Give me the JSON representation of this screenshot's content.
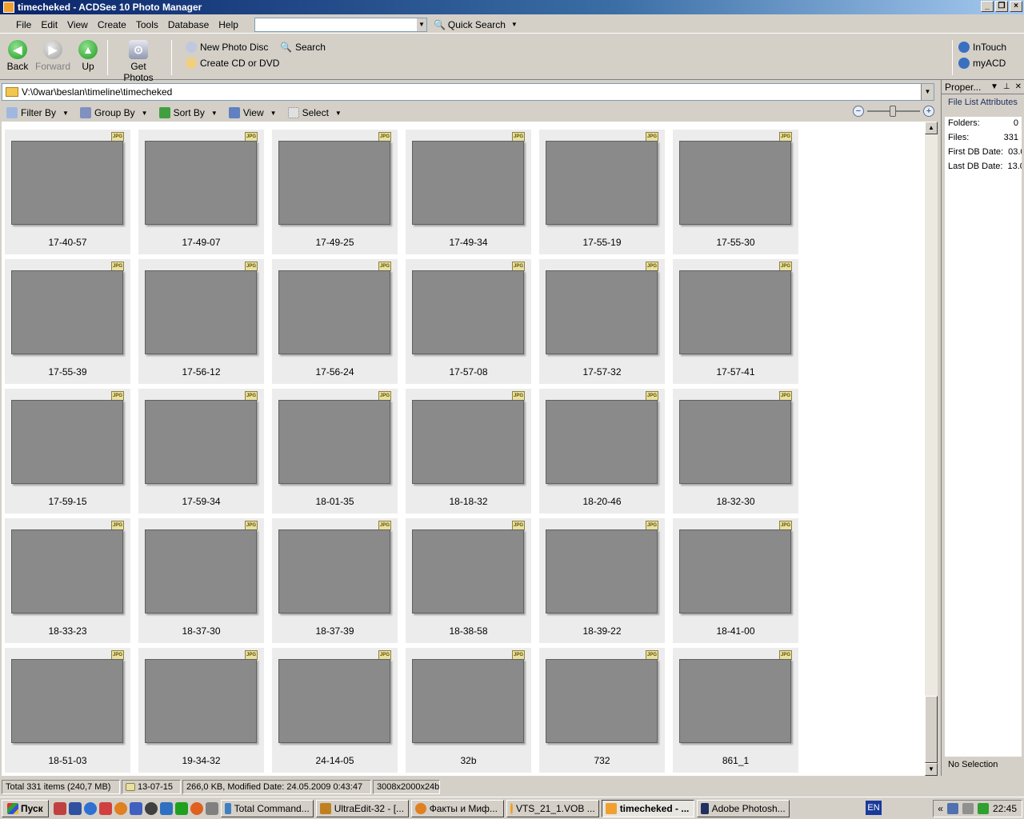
{
  "window": {
    "title": "timecheked - ACDSee 10 Photo Manager",
    "controls": [
      "_",
      "❐",
      "×"
    ]
  },
  "menu": {
    "items": [
      "File",
      "Edit",
      "View",
      "Create",
      "Tools",
      "Database",
      "Help"
    ],
    "quick_search": "Quick Search"
  },
  "toolbar": {
    "back": "Back",
    "forward": "Forward",
    "up": "Up",
    "get_photos": "Get Photos",
    "new_photo_disc": "New Photo Disc",
    "create_cd": "Create CD or DVD",
    "search": "Search",
    "intouch": "InTouch",
    "myacd": "myACD"
  },
  "path": "V:\\0war\\beslan\\timeline\\timecheked",
  "filterbar": {
    "filter_by": "Filter By",
    "group_by": "Group By",
    "sort_by": "Sort By",
    "view": "View",
    "select": "Select"
  },
  "badge_label": "JPG",
  "files": [
    "17-40-57",
    "17-49-07",
    "17-49-25",
    "17-49-34",
    "17-55-19",
    "17-55-30",
    "17-55-39",
    "17-56-12",
    "17-56-24",
    "17-57-08",
    "17-57-32",
    "17-57-41",
    "17-59-15",
    "17-59-34",
    "18-01-35",
    "18-18-32",
    "18-20-46",
    "18-32-30",
    "18-33-23",
    "18-37-30",
    "18-37-39",
    "18-38-58",
    "18-39-22",
    "18-41-00",
    "18-51-03",
    "19-34-32",
    "24-14-05",
    "32b",
    "732",
    "861_1"
  ],
  "properties": {
    "title": "Proper...",
    "tab": "File List Attributes",
    "rows": [
      {
        "label": "Folders:",
        "value": "0"
      },
      {
        "label": "Files:",
        "value": "331"
      },
      {
        "label": "First DB Date:",
        "value": "03.0"
      },
      {
        "label": "Last DB Date:",
        "value": "13.0"
      }
    ],
    "no_selection": "No Selection"
  },
  "status": {
    "total": "Total 331 items  (240,7 MB)",
    "current": "13-07-15",
    "info": "266,0 KB, Modified Date: 24.05.2009 0:43:47",
    "dims": "3008x2000x24b"
  },
  "taskbar": {
    "start": "Пуск",
    "tasks": [
      {
        "label": "Total Command...",
        "active": false
      },
      {
        "label": "UltraEdit-32 - [...",
        "active": false
      },
      {
        "label": "Факты и Миф...",
        "active": false
      },
      {
        "label": "VTS_21_1.VOB ...",
        "active": false
      },
      {
        "label": "timecheked - ...",
        "active": true
      },
      {
        "label": "Adobe Photosh...",
        "active": false
      }
    ],
    "lang": "EN",
    "clock": "22:45"
  }
}
